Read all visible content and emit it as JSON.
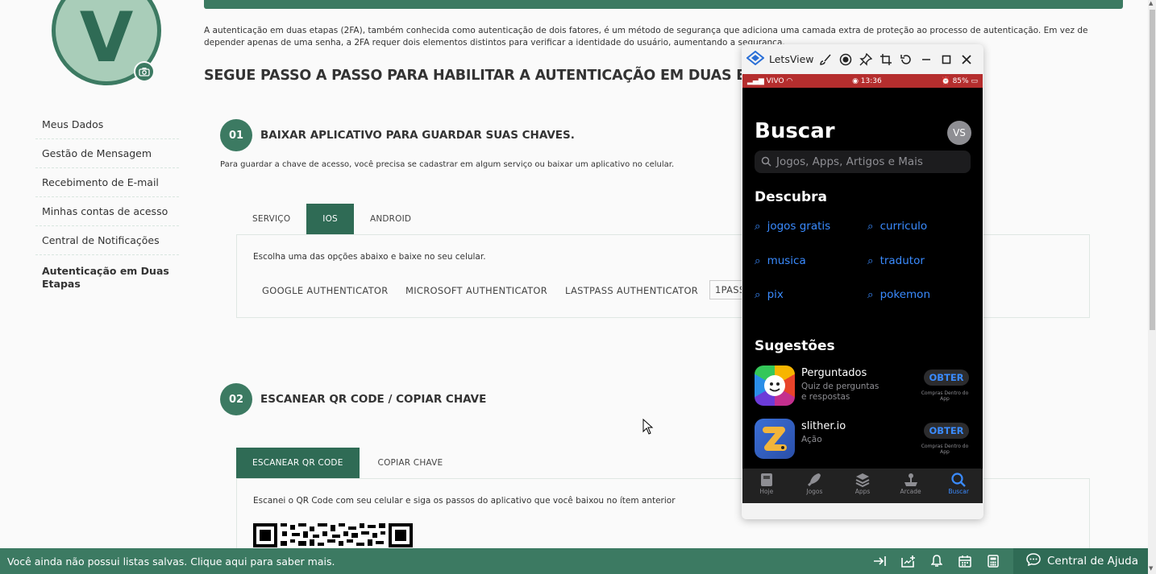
{
  "profile": {
    "initial": "V"
  },
  "sidebar": {
    "items": [
      {
        "label": "Meus Dados"
      },
      {
        "label": "Gestão de Mensagem"
      },
      {
        "label": "Recebimento de E-mail"
      },
      {
        "label": "Minhas contas de acesso"
      },
      {
        "label": "Central de Notificações"
      },
      {
        "label": "Autenticação em Duas Etapas"
      }
    ]
  },
  "main": {
    "intro": "A autenticação em duas etapas (2FA), também conhecida como autenticação de dois fatores, é um método de segurança que adiciona uma camada extra de proteção ao processo de autenticação. Em vez de depender apenas de uma senha, a 2FA requer dois elementos distintos para verificar a identidade do usuário, aumentando a segurança.",
    "heading": "SEGUE PASSO A PASSO PARA HABILITAR A AUTENTICAÇÃO EM DUAS ETAPAS:",
    "step1": {
      "number": "01",
      "title": "BAIXAR APLICATIVO PARA GUARDAR SUAS CHAVES.",
      "description": "Para guardar a chave de acesso, você precisa se cadastrar em algum serviço ou baixar um aplicativo no celular.",
      "tabs": [
        "SERVIÇO",
        "IOS",
        "ANDROID"
      ],
      "panel_text": "Escolha uma das opções abaixo e baixe no seu celular.",
      "apps": [
        "GOOGLE AUTHENTICATOR",
        "MICROSOFT AUTHENTICATOR",
        "LASTPASS AUTHENTICATOR",
        "1PASS"
      ]
    },
    "step2": {
      "number": "02",
      "title": "ESCANEAR QR CODE / COPIAR CHAVE",
      "tabs": [
        "ESCANEAR QR CODE",
        "COPIAR CHAVE"
      ],
      "panel_text": "Escanei o QR Code com seu celular e siga os passos do aplicativo que você baixou no ítem anterior"
    }
  },
  "bottombar": {
    "message": "Você ainda não possui listas salvas. Clique aqui para saber mais.",
    "help_label": "Central de Ajuda",
    "icons": [
      "collapse-icon",
      "add-list-icon",
      "bell-icon",
      "calendar-icon",
      "calculator-icon"
    ]
  },
  "letsview": {
    "app_name": "LetsView",
    "phone": {
      "carrier": "VIVO",
      "time": "13:36",
      "battery": "85%",
      "title": "Buscar",
      "avatar": "VS",
      "search_placeholder": "Jogos, Apps, Artigos e Mais",
      "discover_heading": "Descubra",
      "discover": [
        "jogos gratis",
        "curriculo",
        "musica",
        "tradutor",
        "pix",
        "pokemon"
      ],
      "suggestions_heading": "Sugestões",
      "suggestions": [
        {
          "name": "Perguntados",
          "subtitle": "Quiz de perguntas e respostas",
          "button": "OBTER",
          "note": "Compras Dentro do App"
        },
        {
          "name": "slither.io",
          "subtitle": "Ação",
          "button": "OBTER",
          "note": "Compras Dentro do App"
        }
      ],
      "tabbar": [
        "Hoje",
        "Jogos",
        "Apps",
        "Arcade",
        "Buscar"
      ]
    }
  },
  "colors": {
    "primary": "#3c7a62",
    "primary_dark": "#2f6b55",
    "ios_blue": "#3a8bff",
    "status_red": "#b52e2e"
  }
}
